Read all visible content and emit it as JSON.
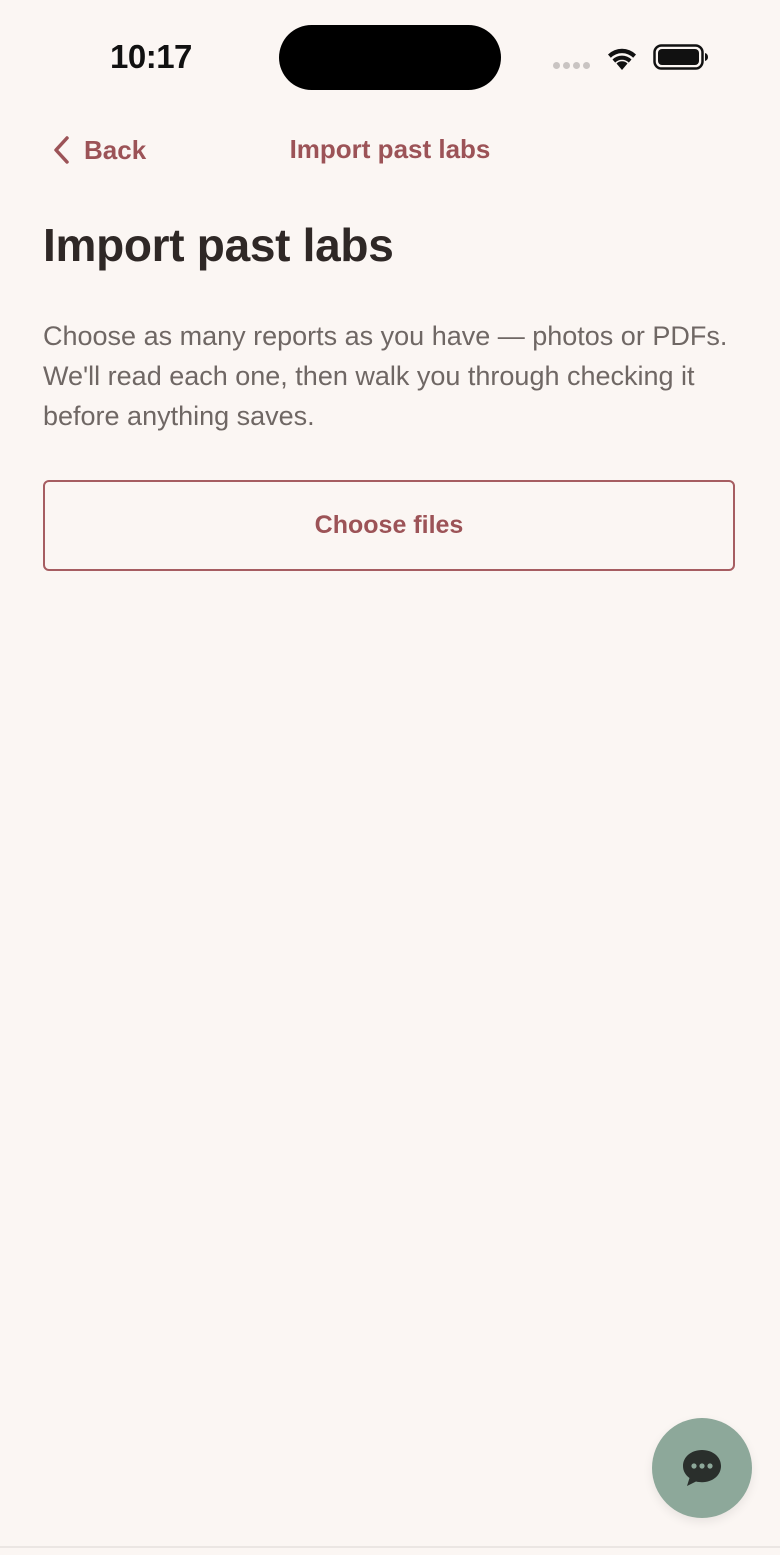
{
  "status_bar": {
    "time": "10:17"
  },
  "nav": {
    "back_label": "Back",
    "title": "Import past labs"
  },
  "main": {
    "title": "Import past labs",
    "description": "Choose as many reports as you have — photos or PDFs. We'll read each one, then walk you through checking it before anything saves.",
    "choose_files_label": "Choose files"
  },
  "icons": {
    "back": "chevron-left-icon",
    "wifi": "wifi-icon",
    "battery": "battery-icon",
    "chat": "chat-bubble-icon"
  },
  "colors": {
    "background": "#fbf6f3",
    "accent": "#9c5357",
    "fab": "#8da89a",
    "text_primary": "#2f2826",
    "text_secondary": "#6f6764"
  }
}
